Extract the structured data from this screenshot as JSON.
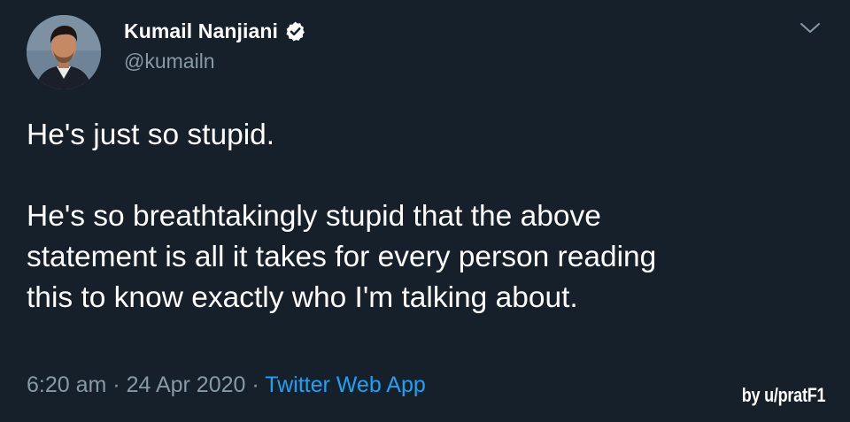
{
  "author": {
    "display_name": "Kumail Nanjiani",
    "handle": "@kumailn",
    "verified": true
  },
  "tweet": {
    "text": "He's just so stupid.\n\nHe's so breathtakingly stupid that the above\nstatement is all it takes for every person reading\nthis to know exactly who I'm talking about."
  },
  "meta": {
    "time": "6:20 am",
    "separator": "·",
    "date": "24 Apr 2020",
    "source": "Twitter Web App"
  },
  "watermark": "by u/pratF1",
  "icons": {
    "verified": "verified-badge-icon",
    "menu": "chevron-down-icon"
  },
  "colors": {
    "background": "#15202b",
    "secondary_text": "#8899a6",
    "link": "#1da1f2",
    "verified_badge": "#ffffff"
  }
}
